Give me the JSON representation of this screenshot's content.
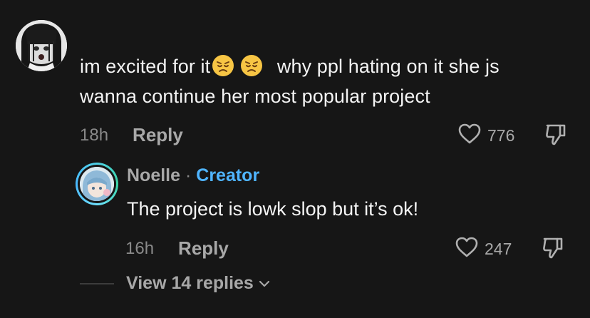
{
  "comment": {
    "text_part1": "im excited for it",
    "emoji_1": "disappointed-face-emoji",
    "emoji_2": "disappointed-face-emoji",
    "text_part2": "why ppl hating on it she js",
    "text_line2": "wanna continue her most popular project",
    "time": "18h",
    "reply_label": "Reply",
    "likes": "776",
    "like_icon": "heart-outline-icon",
    "dislike_icon": "thumbs-down-icon"
  },
  "reply": {
    "author": "Noelle",
    "separator": "·",
    "badge": "Creator",
    "text": "The project is lowk slop but it’s ok!",
    "time": "16h",
    "reply_label": "Reply",
    "likes": "247"
  },
  "thread": {
    "view_replies": "View 14 replies",
    "chevron_icon": "chevron-down-icon"
  },
  "colors": {
    "background": "#161616",
    "text": "#f4f4f4",
    "muted": "#a8a8a8",
    "creator_badge": "#4fb4ff"
  }
}
